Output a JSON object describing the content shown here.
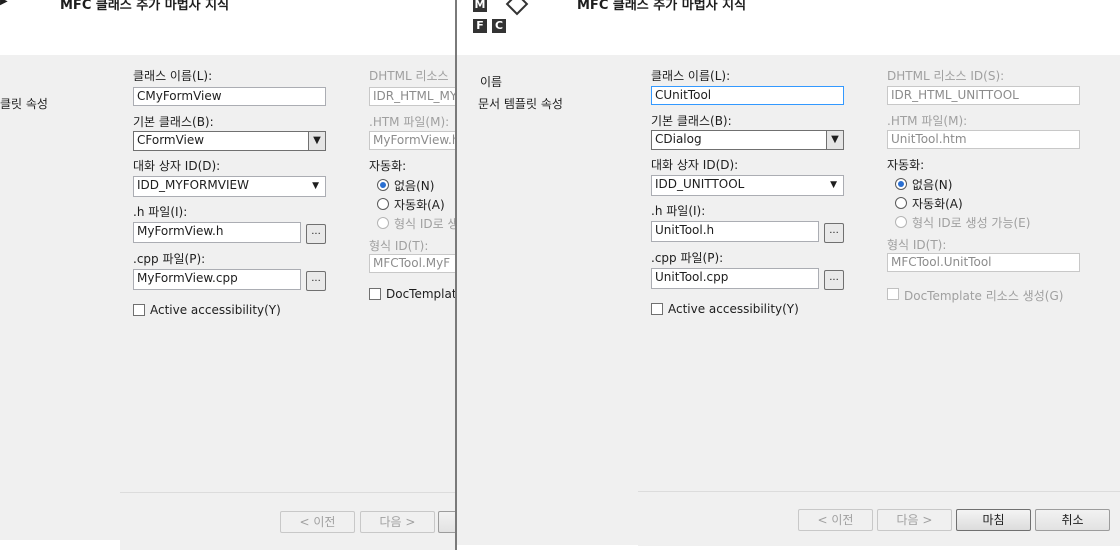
{
  "left": {
    "title": "MFC 클래스 추가 마법사 지식",
    "nav": {
      "items": [
        "클릿 속성"
      ]
    },
    "form": {
      "class_name_label": "클래스 이름(L):",
      "class_name_value": "CMyFormView",
      "base_class_label": "기본 클래스(B):",
      "base_class_value": "CFormView",
      "dialog_id_label": "대화 상자 ID(D):",
      "dialog_id_value": "IDD_MYFORMVIEW",
      "h_file_label": ".h 파일(I):",
      "h_file_value": "MyFormView.h",
      "cpp_file_label": ".cpp 파일(P):",
      "cpp_file_value": "MyFormView.cpp",
      "accessibility_label": "Active accessibility(Y)",
      "dhtml_id_label": "DHTML 리소스",
      "dhtml_id_value": "IDR_HTML_MY",
      "htm_file_label": ".HTM 파일(M):",
      "htm_file_value": "MyFormView.h",
      "automation_label": "자동화:",
      "radio_none": "없음(N)",
      "radio_automation": "자동화(A)",
      "radio_typeid": "형식 ID로 생",
      "type_id_label": "형식 ID(T):",
      "type_id_value": "MFCTool.MyF",
      "doctemplate_label": "DocTemplate"
    },
    "footer": {
      "prev": "< 이전",
      "next": "다음 >"
    }
  },
  "right": {
    "title": "MFC 클래스 추가 마법사 지식",
    "logo": [
      "M",
      "F",
      "C"
    ],
    "nav": {
      "items": [
        "이름",
        "문서 템플릿 속성"
      ]
    },
    "form": {
      "class_name_label": "클래스 이름(L):",
      "class_name_value": "CUnitTool",
      "base_class_label": "기본 클래스(B):",
      "base_class_value": "CDialog",
      "dialog_id_label": "대화 상자 ID(D):",
      "dialog_id_value": "IDD_UNITTOOL",
      "h_file_label": ".h 파일(I):",
      "h_file_value": "UnitTool.h",
      "cpp_file_label": ".cpp 파일(P):",
      "cpp_file_value": "UnitTool.cpp",
      "accessibility_label": "Active accessibility(Y)",
      "dhtml_id_label": "DHTML 리소스 ID(S):",
      "dhtml_id_value": "IDR_HTML_UNITTOOL",
      "htm_file_label": ".HTM 파일(M):",
      "htm_file_value": "UnitTool.htm",
      "automation_label": "자동화:",
      "radio_none": "없음(N)",
      "radio_automation": "자동화(A)",
      "radio_typeid": "형식 ID로 생성 가능(E)",
      "type_id_label": "형식 ID(T):",
      "type_id_value": "MFCTool.UnitTool",
      "doctemplate_label": "DocTemplate 리소스 생성(G)"
    },
    "footer": {
      "prev": "< 이전",
      "next": "다음 >",
      "finish": "마침",
      "cancel": "취소"
    }
  }
}
